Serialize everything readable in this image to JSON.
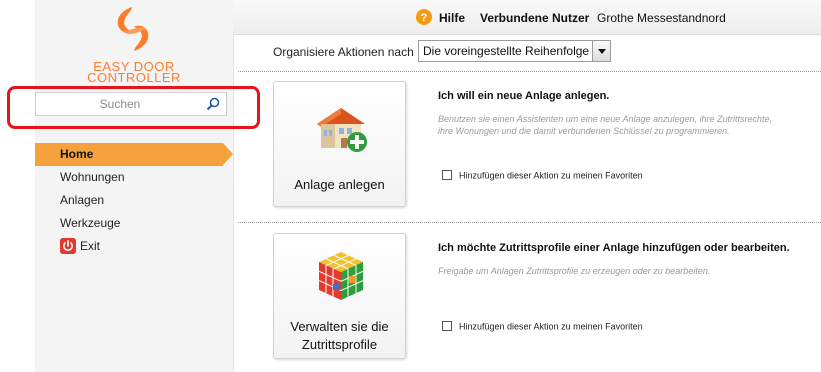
{
  "brand": {
    "line1": "EASY DOOR",
    "line2": "CONTROLLER",
    "color": "#ff7b2c"
  },
  "search": {
    "placeholder": "Suchen",
    "icon": "search-icon"
  },
  "header": {
    "help_label": "Hilfe",
    "connected_users_label": "Verbundene Nutzer",
    "current_user": "Grothe Messestandnord"
  },
  "nav": {
    "items": [
      {
        "label": "Home",
        "active": true
      },
      {
        "label": "Wohnungen"
      },
      {
        "label": "Anlagen"
      },
      {
        "label": "Werkzeuge"
      },
      {
        "label": "Exit",
        "icon": "power-icon"
      }
    ]
  },
  "toolbar": {
    "organize_label": "Organisiere Aktionen nach",
    "organize_value": "Die voreingestellte Reihenfolge"
  },
  "actions": [
    {
      "tile_label": "Anlage anlegen",
      "icon": "building-add-icon",
      "title": "Ich will ein neue Anlage anlegen.",
      "description": "Benutzen sie einen Assistenten um eine neue Anlage anzulegen, ihre Zutrittsrechte, ihre Wonungen und die damit verbundenen Schlüssel zu programmieren.",
      "favorite_label": "Hinzufügen dieser Aktion zu meinen Favoriten"
    },
    {
      "tile_label_line1": "Verwalten sie die",
      "tile_label_line2": "Zutrittsprofile",
      "icon": "rubiks-cube-icon",
      "title": "Ich möchte Zutrittsprofile einer Anlage hinzufügen oder bearbeiten.",
      "description": "Freigabe um Anlagen Zutrittsprofile zu erzeugen oder zu bearbeiten.",
      "favorite_label": "Hinzufügen dieser Aktion zu meinen Favoriten"
    }
  ],
  "colors": {
    "accent": "#f5a23c",
    "highlight": "#e8141b",
    "help_icon": "#f39c12",
    "exit_icon": "#e03a2f"
  }
}
